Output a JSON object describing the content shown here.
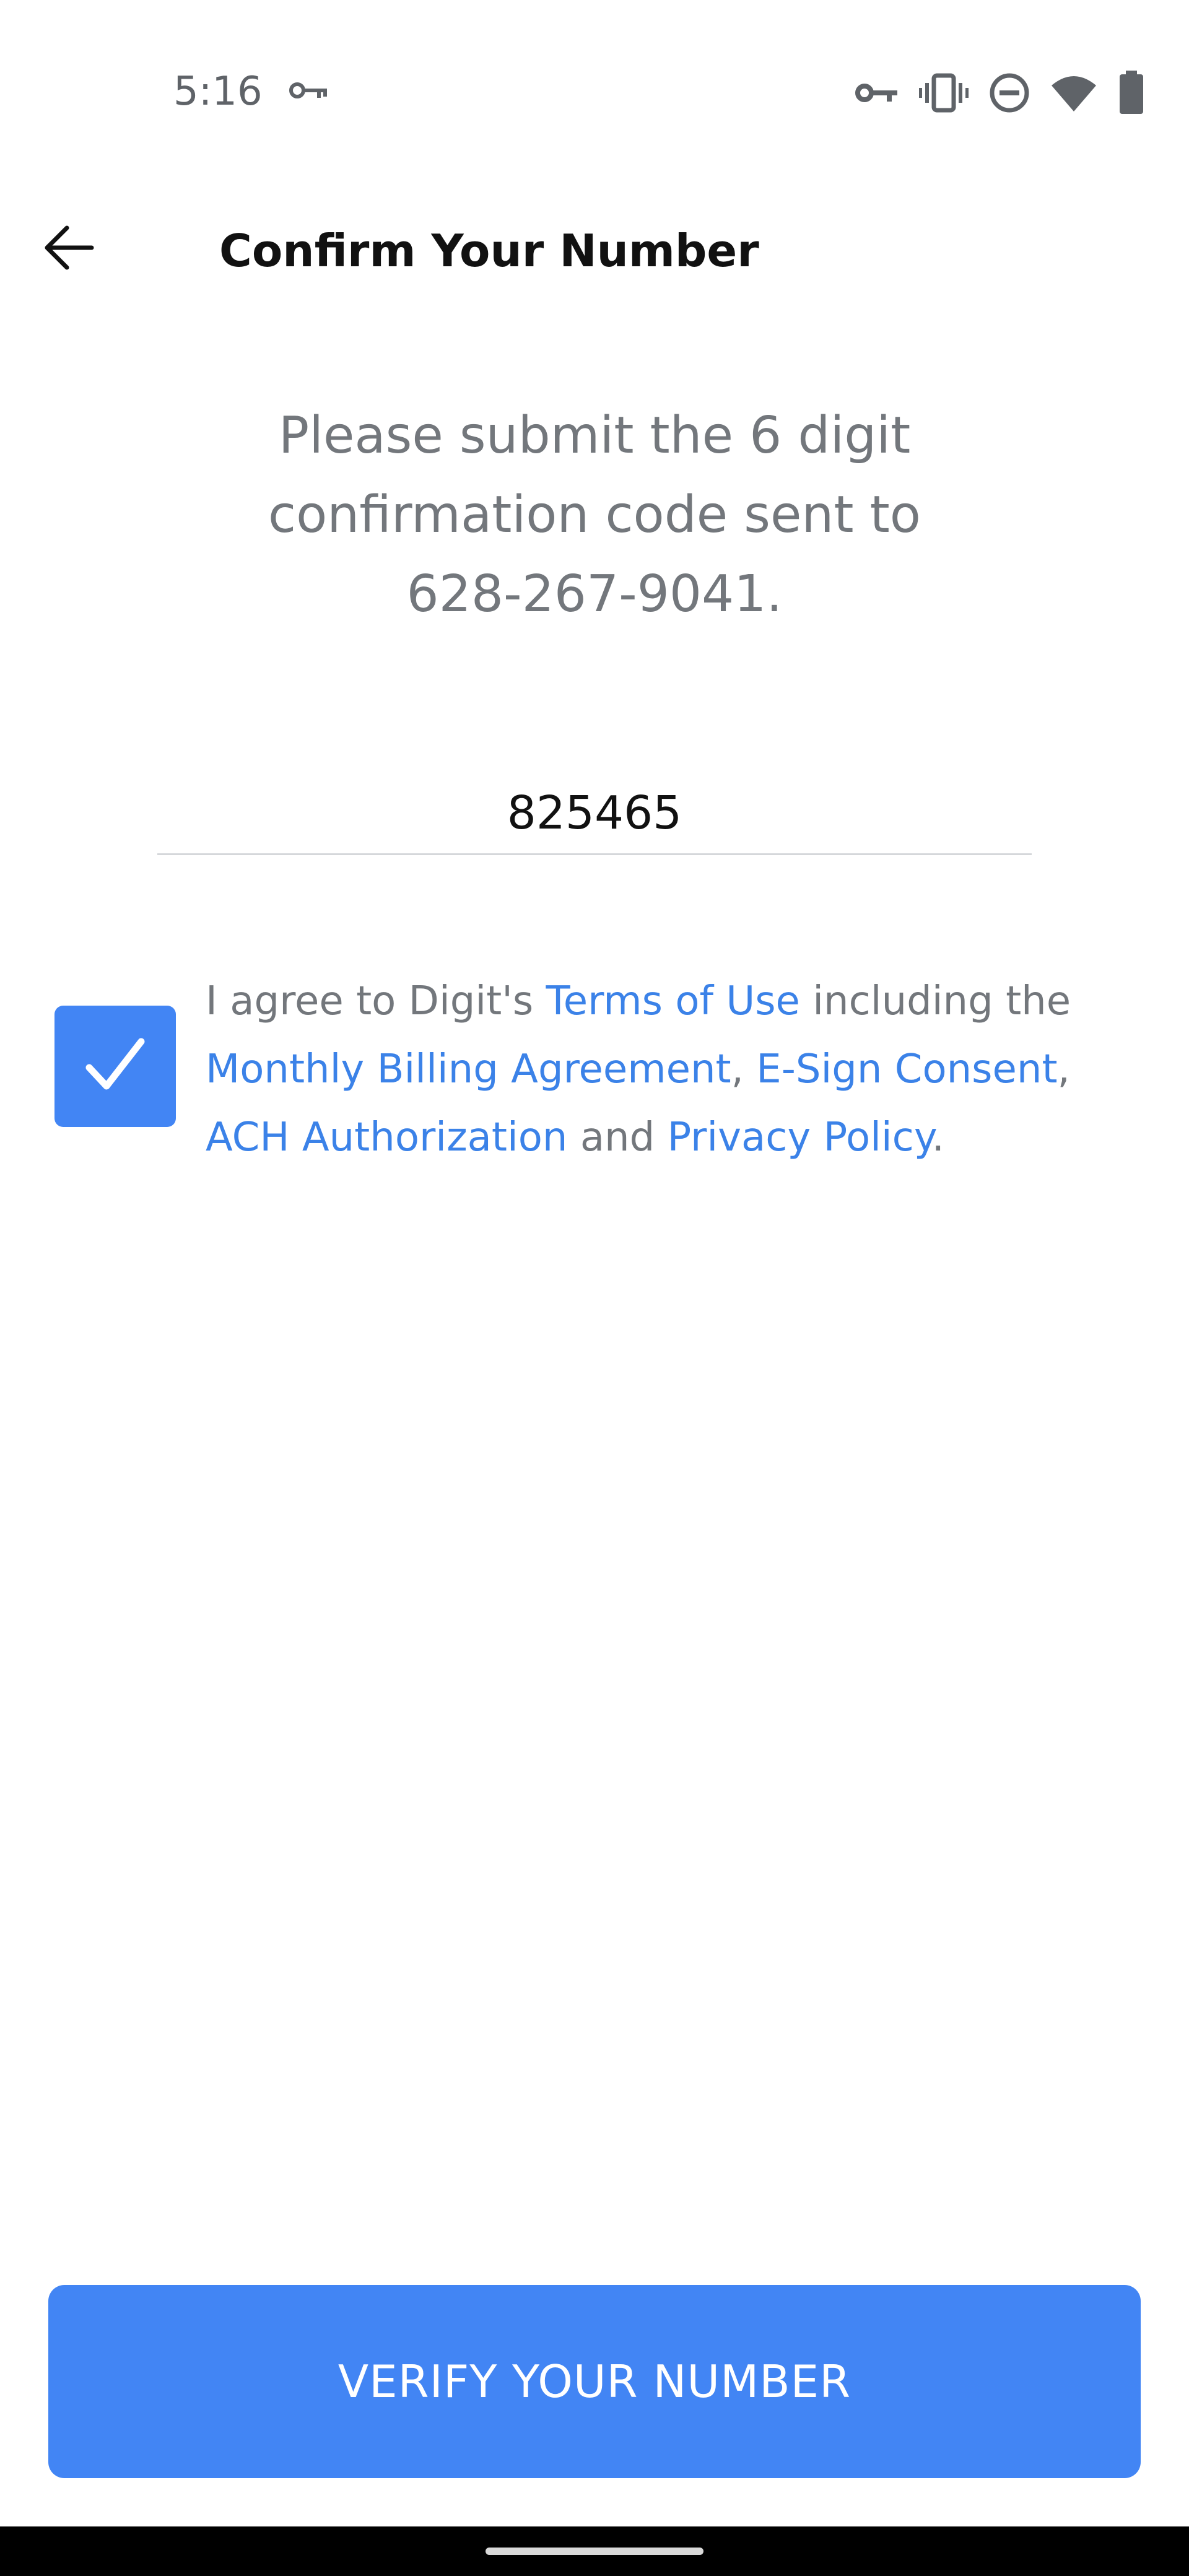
{
  "status_bar": {
    "time": "5:16",
    "icons": [
      "vpn-key-icon",
      "vpn-key-icon",
      "vibrate-icon",
      "do-not-disturb-icon",
      "wifi-icon",
      "battery-icon"
    ]
  },
  "app_bar": {
    "title": "Confirm Your Number",
    "back_icon": "arrow-back-icon"
  },
  "instructions": "Please submit the 6 digit confirmation code sent to 628-267-9041.",
  "code_input": {
    "value": "825465",
    "placeholder": ""
  },
  "agreement": {
    "checked": true,
    "prefix": "I agree to Digit's ",
    "terms_link": "Terms of Use",
    "including": " including the ",
    "billing_link": "Monthly Billing Agreement",
    "comma1": ", ",
    "esign_link": "E-Sign Consent",
    "comma2": ", ",
    "ach_link": "ACH Authorization",
    "and": " and ",
    "privacy_link": "Privacy Policy",
    "period": "."
  },
  "verify_button": {
    "label": "VERIFY YOUR NUMBER"
  },
  "colors": {
    "accent": "#4285f4",
    "link": "#3b82e8",
    "muted_text": "#73777c"
  }
}
